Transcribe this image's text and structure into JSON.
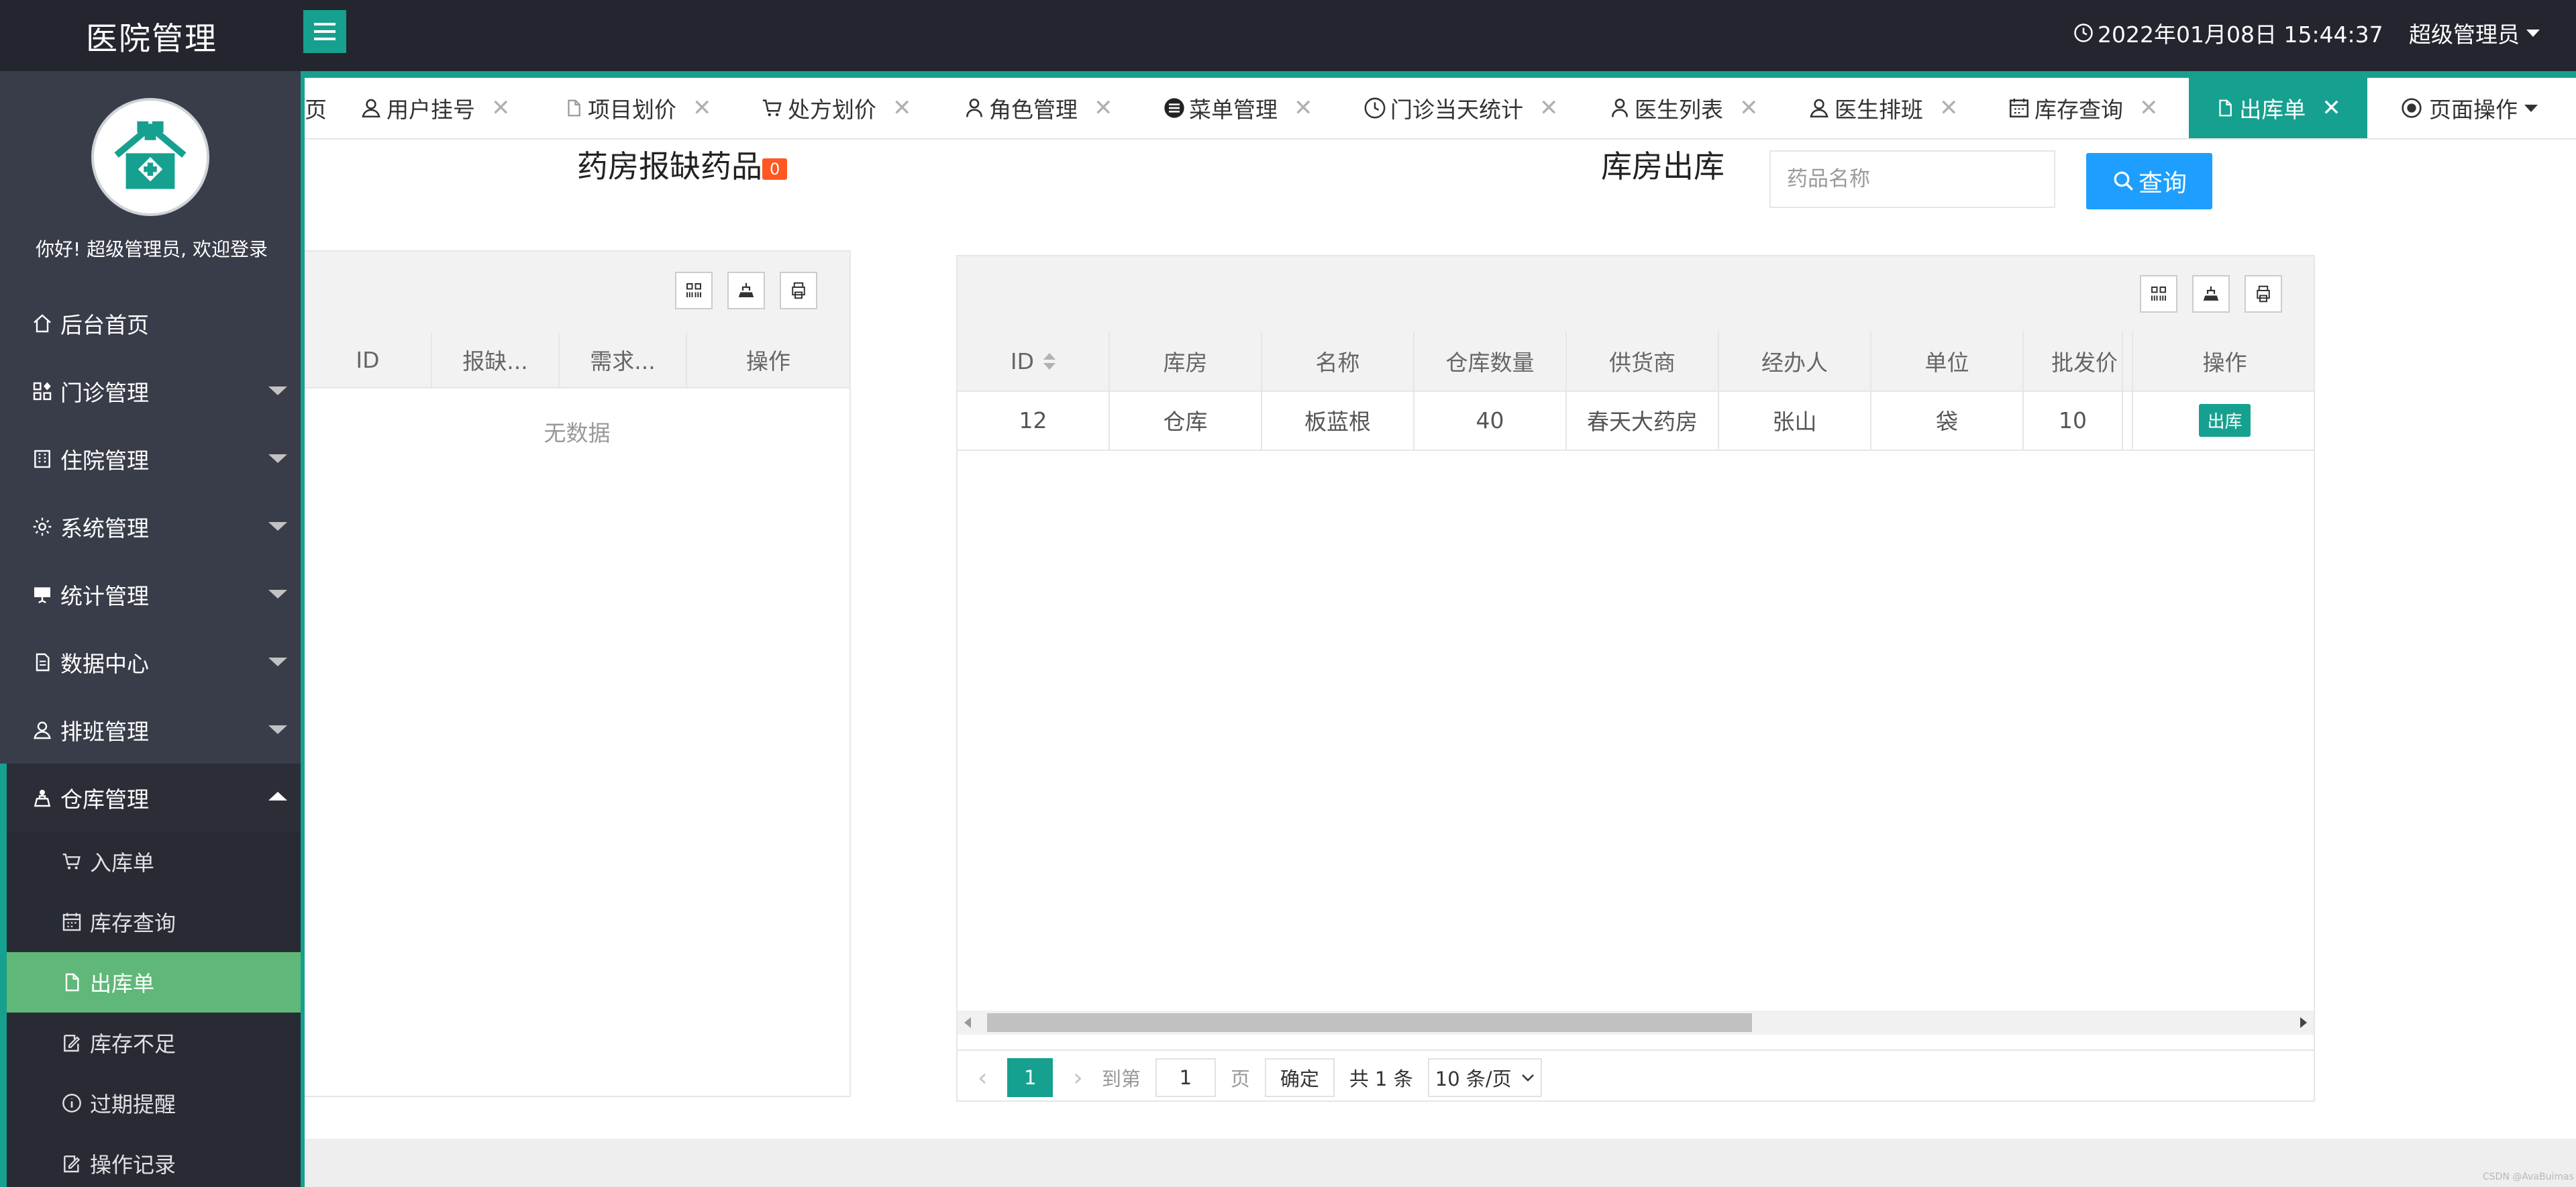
{
  "header": {
    "title": "医院管理",
    "datetime": "2022年01月08日 15:44:37",
    "user": "超级管理员"
  },
  "sidebar": {
    "welcome": "你好! 超级管理员, 欢迎登录",
    "items": [
      {
        "label": "后台首页",
        "icon": "home-icon"
      },
      {
        "label": "门诊管理",
        "icon": "apps-icon"
      },
      {
        "label": "住院管理",
        "icon": "building-icon"
      },
      {
        "label": "系统管理",
        "icon": "gear-icon"
      },
      {
        "label": "统计管理",
        "icon": "chart-board-icon"
      },
      {
        "label": "数据中心",
        "icon": "document-icon"
      },
      {
        "label": "排班管理",
        "icon": "users-icon"
      },
      {
        "label": "仓库管理",
        "icon": "warehouse-icon"
      }
    ],
    "warehouse_children": [
      {
        "label": "入库单",
        "icon": "cart-icon"
      },
      {
        "label": "库存查询",
        "icon": "calendar-icon"
      },
      {
        "label": "出库单",
        "icon": "file-icon"
      },
      {
        "label": "库存不足",
        "icon": "edit-icon"
      },
      {
        "label": "过期提醒",
        "icon": "info-icon"
      },
      {
        "label": "操作记录",
        "icon": "edit-icon"
      }
    ]
  },
  "tabs": [
    {
      "label": "页",
      "icon": ""
    },
    {
      "label": "用户挂号",
      "icon": "user-icon"
    },
    {
      "label": "项目划价",
      "icon": "file-icon"
    },
    {
      "label": "处方划价",
      "icon": "cart-icon"
    },
    {
      "label": "角色管理",
      "icon": "person-icon"
    },
    {
      "label": "菜单管理",
      "icon": "menu-circle-icon"
    },
    {
      "label": "门诊当天统计",
      "icon": "clock-icon"
    },
    {
      "label": "医生列表",
      "icon": "person-icon"
    },
    {
      "label": "医生排班",
      "icon": "user-icon"
    },
    {
      "label": "库存查询",
      "icon": "calendar-icon"
    },
    {
      "label": "出库单",
      "icon": "file-icon"
    }
  ],
  "page_ops": "页面操作",
  "left_panel": {
    "title": "药房报缺药品",
    "badge": "0",
    "columns": [
      "ID",
      "报缺...",
      "需求...",
      "操作"
    ],
    "empty": "无数据"
  },
  "right_panel": {
    "title": "库房出库",
    "search_placeholder": "药品名称",
    "search_button": "查询",
    "columns": [
      "ID",
      "库房",
      "名称",
      "仓库数量",
      "供货商",
      "经办人",
      "单位",
      "批发价",
      "操作"
    ],
    "rows": [
      {
        "id": "12",
        "warehouse": "仓库",
        "name": "板蓝根",
        "qty": "40",
        "supplier": "春天大药房",
        "handler": "张山",
        "unit": "袋",
        "price": "10",
        "action": "出库"
      }
    ],
    "pager": {
      "current": "1",
      "goto_label": "到第",
      "goto_value": "1",
      "page_label": "页",
      "confirm": "确定",
      "total": "共 1 条",
      "page_size": "10 条/页"
    }
  },
  "watermark": "CSDN @AvaBuimas"
}
